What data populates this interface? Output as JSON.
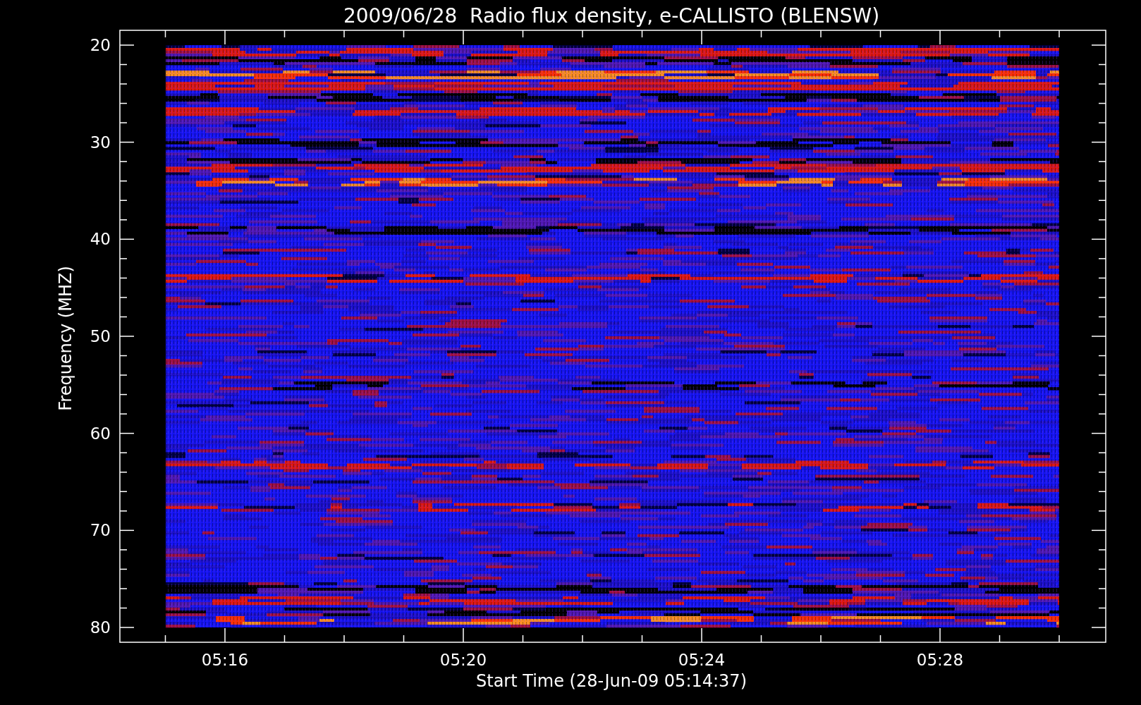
{
  "title": "2009/06/28  Radio flux density, e-CALLISTO (BLENSW)",
  "y_axis": {
    "label": "Frequency (MHZ)",
    "ticks": [
      "20",
      "30",
      "40",
      "50",
      "60",
      "70",
      "80"
    ]
  },
  "x_axis": {
    "label": "Start Time (28-Jun-09 05:14:37)",
    "ticks": [
      "05:16",
      "05:20",
      "05:24",
      "05:28"
    ]
  }
}
